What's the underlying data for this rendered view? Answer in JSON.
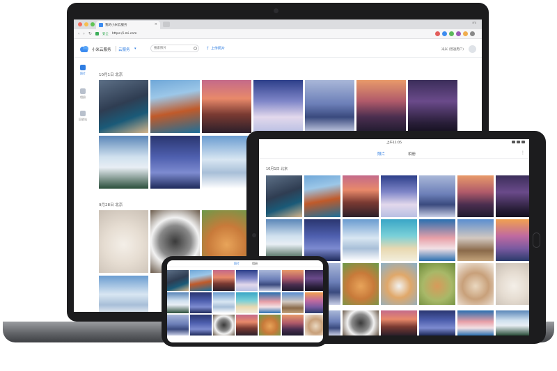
{
  "browser": {
    "tab_title": "我的小米云服务",
    "tab_close": "×",
    "window_label": "mi",
    "secure_label": "安全",
    "url": "https://i.mi.com",
    "nav_back": "‹",
    "nav_forward": "›",
    "nav_reload": "↻"
  },
  "app": {
    "name": "小米云服务",
    "service": "云服务",
    "search_placeholder": "搜索照片",
    "upload_label": "上传照片",
    "user_info": "米米 (普通用户)"
  },
  "left_nav": [
    {
      "label": "照片",
      "icon": "photos-icon",
      "active": true
    },
    {
      "label": "相册",
      "icon": "album-icon",
      "active": false
    },
    {
      "label": "回收站",
      "icon": "trash-icon",
      "active": false
    }
  ],
  "laptop": {
    "sections": [
      {
        "title": "10月1日 北京"
      },
      {
        "title": "9月28日 北京"
      }
    ]
  },
  "tablet": {
    "time": "上午11:05",
    "tabs": [
      "照片",
      "相册"
    ],
    "menu": "⋮",
    "section_title": "10月1日 北京"
  },
  "phone": {
    "tabs": [
      "照片",
      "相册"
    ]
  },
  "colors": {
    "accent": "#2f7de1",
    "device_body": "#1c1c1e",
    "secure_green": "#3cae5a"
  }
}
